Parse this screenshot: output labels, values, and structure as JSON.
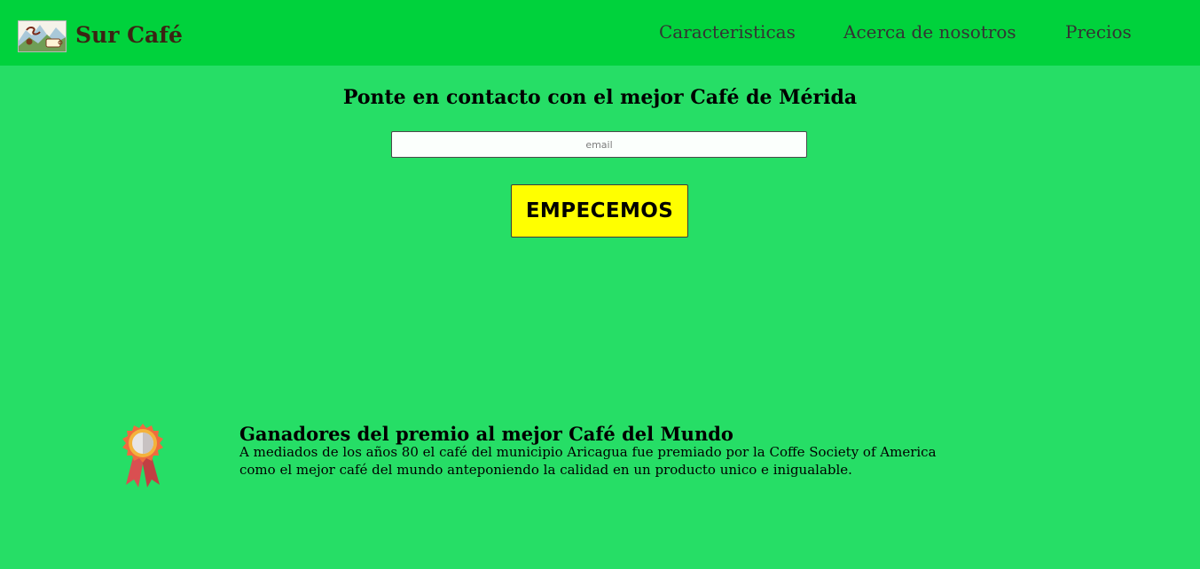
{
  "header": {
    "brand": "Sur Café",
    "logo_icon": "cafe-logo-icon",
    "nav": [
      {
        "label": "Caracteristicas"
      },
      {
        "label": "Acerca de nosotros"
      },
      {
        "label": "Precios"
      }
    ]
  },
  "hero": {
    "title": "Ponte en contacto con el mejor Café de Mérida",
    "email_placeholder": "email",
    "email_value": "",
    "cta_label": "EMPECEMOS"
  },
  "feature": {
    "icon": "award-medal-icon",
    "title": "Ganadores del premio al mejor Café del Mundo",
    "text": "A mediados de los años 80 el café del municipio Aricagua fue premiado por la Coffe Society of America como el mejor café del mundo anteponiendo la calidad en un producto unico e inigualable."
  },
  "colors": {
    "page_background": "#26de66",
    "header_background": "#00d23c",
    "cta_background": "#ffff00",
    "brand_text": "#3b2413"
  }
}
